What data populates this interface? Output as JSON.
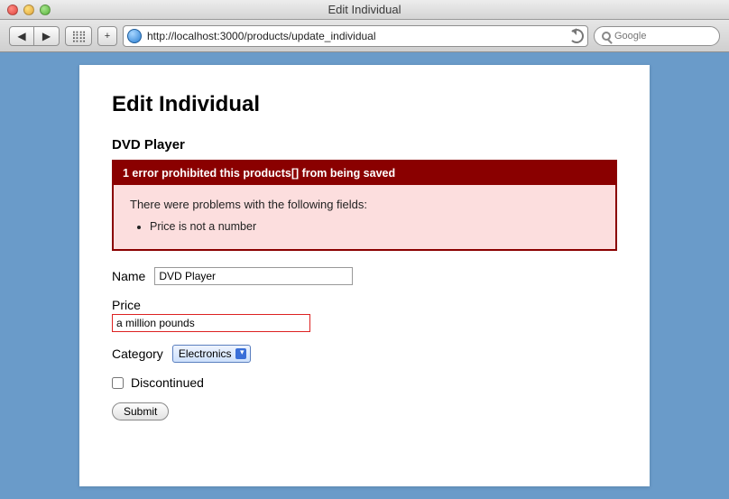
{
  "window": {
    "title": "Edit Individual",
    "url": "http://localhost:3000/products/update_individual",
    "search_placeholder": "Google"
  },
  "page": {
    "heading": "Edit Individual",
    "product_name": "DVD Player"
  },
  "error": {
    "header": "1 error prohibited this products[] from being saved",
    "intro": "There were problems with the following fields:",
    "items": [
      "Price is not a number"
    ]
  },
  "form": {
    "name_label": "Name",
    "name_value": "DVD Player",
    "price_label": "Price",
    "price_value": "a million pounds",
    "category_label": "Category",
    "category_value": "Electronics",
    "discontinued_label": "Discontinued",
    "discontinued_checked": false,
    "submit_label": "Submit"
  }
}
